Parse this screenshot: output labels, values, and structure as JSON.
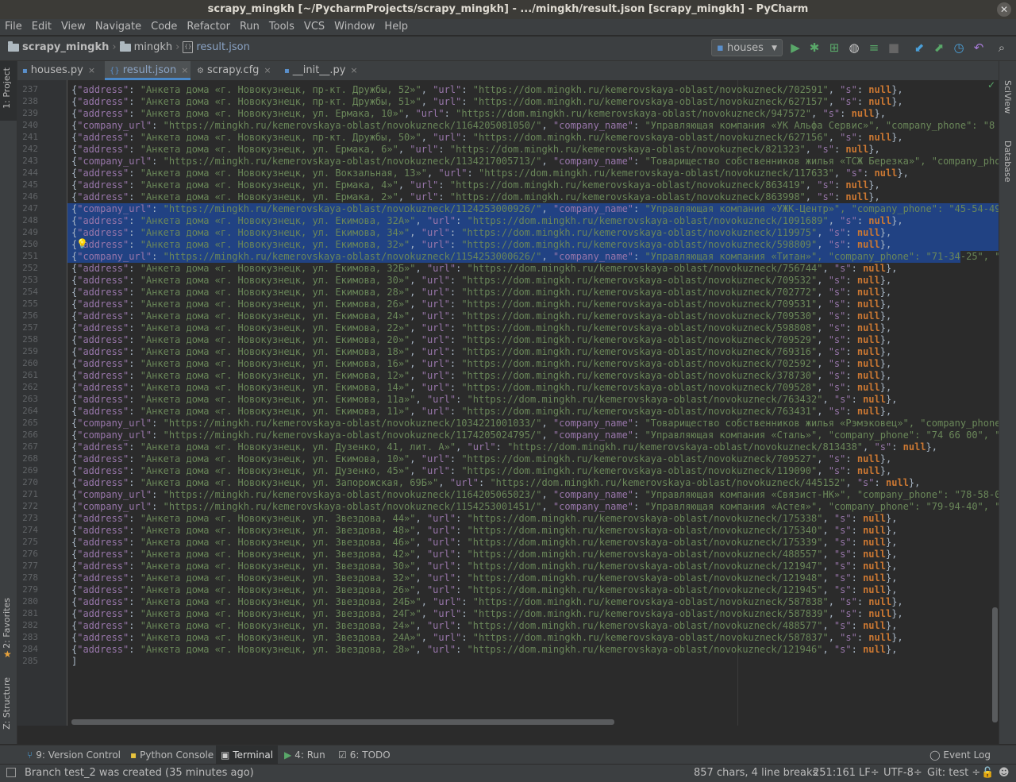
{
  "window": {
    "title": "scrapy_mingkh [~/PycharmProjects/scrapy_mingkh] - .../mingkh/result.json [scrapy_mingkh] - PyCharm"
  },
  "menu": [
    "File",
    "Edit",
    "View",
    "Navigate",
    "Code",
    "Refactor",
    "Run",
    "Tools",
    "VCS",
    "Window",
    "Help"
  ],
  "breadcrumb": {
    "project": "scrapy_mingkh",
    "folder": "mingkh",
    "file": "result.json"
  },
  "run_config": {
    "label": "houses"
  },
  "tabs": [
    {
      "label": "houses.py"
    },
    {
      "label": "result.json"
    },
    {
      "label": "scrapy.cfg"
    },
    {
      "label": "__init__.py"
    }
  ],
  "left_tools": {
    "project": "1: Project",
    "favorites": "2: Favorites",
    "structure": "Z: Structure"
  },
  "right_tools": {
    "sciview": "SciView",
    "database": "Database"
  },
  "lines": [
    {
      "n": "237",
      "t": "a",
      "addr": "Анкета дома «г. Новокузнецк, пр-кт. Дружбы, 52»",
      "id": "702591"
    },
    {
      "n": "238",
      "t": "a",
      "addr": "Анкета дома «г. Новокузнецк, пр-кт. Дружбы, 51»",
      "id": "627157"
    },
    {
      "n": "239",
      "t": "a",
      "addr": "Анкета дома «г. Новокузнецк, ул. Ермака, 10»",
      "id": "947572"
    },
    {
      "n": "240",
      "t": "c",
      "id": "1164205081050",
      "name": "Управляющая компания «УК Альфа Сервис»",
      "tail": ", \"company_phone\": \"8 (3843"
    },
    {
      "n": "241",
      "t": "a",
      "addr": "Анкета дома «г. Новокузнецк, пр-кт. Дружбы, 50»",
      "id": "627156"
    },
    {
      "n": "242",
      "t": "a",
      "addr": "Анкета дома «г. Новокузнецк, ул. Ермака, 6»",
      "id": "821323"
    },
    {
      "n": "243",
      "t": "c",
      "id": "1134217005713",
      "name": "Товарищество собственников жилья «ТСЖ Березка»",
      "tail": ", \"company_phone\":"
    },
    {
      "n": "244",
      "t": "a",
      "addr": "Анкета дома «г. Новокузнецк, ул. Вокзальная, 13»",
      "id": "117633"
    },
    {
      "n": "245",
      "t": "a",
      "addr": "Анкета дома «г. Новокузнецк, ул. Ермака, 4»",
      "id": "863419"
    },
    {
      "n": "246",
      "t": "a",
      "addr": "Анкета дома «г. Новокузнецк, ул. Ермака, 2»",
      "id": "863998"
    },
    {
      "n": "247",
      "t": "c",
      "id": "1124253000926",
      "name": "Управляющая компания «УЖК-Центр»",
      "tail": ", \"company_phone\": \"45-54-49-33-7"
    },
    {
      "n": "248",
      "t": "a",
      "addr": "Анкета дома «г. Новокузнецк, ул. Екимова, 32А»",
      "id": "1091689"
    },
    {
      "n": "249",
      "t": "a",
      "addr": "Анкета дома «г. Новокузнецк, ул. Екимова, 34»",
      "id": "119975"
    },
    {
      "n": "250",
      "t": "a",
      "addr": "Анкета дома «г. Новокузнецк, ул. Екимова, 32»",
      "id": "598809"
    },
    {
      "n": "251",
      "t": "c",
      "id": "1154253000626",
      "name": "Управляющая компания «Титан»",
      "tail": ", \"company_phone\": \"71-34-25\", \"compa"
    },
    {
      "n": "252",
      "t": "a",
      "addr": "Анкета дома «г. Новокузнецк, ул. Екимова, 32Б»",
      "id": "756744"
    },
    {
      "n": "253",
      "t": "a",
      "addr": "Анкета дома «г. Новокузнецк, ул. Екимова, 30»",
      "id": "709532"
    },
    {
      "n": "254",
      "t": "a",
      "addr": "Анкета дома «г. Новокузнецк, ул. Екимова, 28»",
      "id": "702772"
    },
    {
      "n": "255",
      "t": "a",
      "addr": "Анкета дома «г. Новокузнецк, ул. Екимова, 26»",
      "id": "709531"
    },
    {
      "n": "256",
      "t": "a",
      "addr": "Анкета дома «г. Новокузнецк, ул. Екимова, 24»",
      "id": "709530"
    },
    {
      "n": "257",
      "t": "a",
      "addr": "Анкета дома «г. Новокузнецк, ул. Екимова, 22»",
      "id": "598808"
    },
    {
      "n": "258",
      "t": "a",
      "addr": "Анкета дома «г. Новокузнецк, ул. Екимова, 20»",
      "id": "709529"
    },
    {
      "n": "259",
      "t": "a",
      "addr": "Анкета дома «г. Новокузнецк, ул. Екимова, 18»",
      "id": "769316"
    },
    {
      "n": "260",
      "t": "a",
      "addr": "Анкета дома «г. Новокузнецк, ул. Екимова, 16»",
      "id": "702592"
    },
    {
      "n": "261",
      "t": "a",
      "addr": "Анкета дома «г. Новокузнецк, ул. Екимова, 12»",
      "id": "378730"
    },
    {
      "n": "262",
      "t": "a",
      "addr": "Анкета дома «г. Новокузнецк, ул. Екимова, 14»",
      "id": "709528"
    },
    {
      "n": "263",
      "t": "a",
      "addr": "Анкета дома «г. Новокузнецк, ул. Екимова, 11а»",
      "id": "763432"
    },
    {
      "n": "264",
      "t": "a",
      "addr": "Анкета дома «г. Новокузнецк, ул. Екимова, 11»",
      "id": "763431"
    },
    {
      "n": "265",
      "t": "c",
      "id": "1034221001033",
      "name": "Товарищество собственников жилья «Рэмэковец»",
      "tail": ", \"company_phone\": \"8"
    },
    {
      "n": "266",
      "t": "c",
      "id": "1174205024795",
      "name": "Управляющая компания «Сталь»",
      "tail": ", \"company_phone\": \"74 66 00\", \"compa"
    },
    {
      "n": "267",
      "t": "a",
      "addr": "Анкета дома «г. Новокузнецк, ул. Дузенко, 41, лит. А»",
      "id": "813438"
    },
    {
      "n": "268",
      "t": "a",
      "addr": "Анкета дома «г. Новокузнецк, ул. Екимова, 10»",
      "id": "709527"
    },
    {
      "n": "269",
      "t": "a",
      "addr": "Анкета дома «г. Новокузнецк, ул. Дузенко, 45»",
      "id": "119090"
    },
    {
      "n": "270",
      "t": "a",
      "addr": "Анкета дома «г. Новокузнецк, ул. Запорожская, 69Б»",
      "id": "445152"
    },
    {
      "n": "271",
      "t": "c",
      "id": "1164205065023",
      "name": "Управляющая компания «Связист-НК»",
      "tail": ", \"company_phone\": \"78-58-01\", \""
    },
    {
      "n": "272",
      "t": "c",
      "id": "1154253001451",
      "name": "Управляющая компания «Астея»",
      "tail": ", \"company_phone\": \"79-94-40\", \"compa"
    },
    {
      "n": "273",
      "t": "a",
      "addr": "Анкета дома «г. Новокузнецк, ул. Звездова, 44»",
      "id": "175338"
    },
    {
      "n": "274",
      "t": "a",
      "addr": "Анкета дома «г. Новокузнецк, ул. Звездова, 48»",
      "id": "175340"
    },
    {
      "n": "275",
      "t": "a",
      "addr": "Анкета дома «г. Новокузнецк, ул. Звездова, 46»",
      "id": "175339"
    },
    {
      "n": "276",
      "t": "a",
      "addr": "Анкета дома «г. Новокузнецк, ул. Звездова, 42»",
      "id": "488557"
    },
    {
      "n": "277",
      "t": "a",
      "addr": "Анкета дома «г. Новокузнецк, ул. Звездова, 30»",
      "id": "121947"
    },
    {
      "n": "278",
      "t": "a",
      "addr": "Анкета дома «г. Новокузнецк, ул. Звездова, 32»",
      "id": "121948"
    },
    {
      "n": "279",
      "t": "a",
      "addr": "Анкета дома «г. Новокузнецк, ул. Звездова, 26»",
      "id": "121945"
    },
    {
      "n": "280",
      "t": "a",
      "addr": "Анкета дома «г. Новокузнецк, ул. Звездова, 24Б»",
      "id": "587838"
    },
    {
      "n": "281",
      "t": "a",
      "addr": "Анкета дома «г. Новокузнецк, ул. Звездова, 24Г»",
      "id": "587839"
    },
    {
      "n": "282",
      "t": "a",
      "addr": "Анкета дома «г. Новокузнецк, ул. Звездова, 24»",
      "id": "488577"
    },
    {
      "n": "283",
      "t": "a",
      "addr": "Анкета дома «г. Новокузнецк, ул. Звездова, 24А»",
      "id": "587837"
    },
    {
      "n": "284",
      "t": "a",
      "addr": "Анкета дома «г. Новокузнецк, ул. Звездова, 28»",
      "id": "121946"
    },
    {
      "n": "285",
      "t": "end",
      "text": "]"
    }
  ],
  "selected_lines": [
    "247",
    "248",
    "249",
    "250",
    "251"
  ],
  "bottom_tools": [
    {
      "label": "9: Version Control",
      "icon": "version-control-icon"
    },
    {
      "label": "Python Console",
      "icon": "python-icon"
    },
    {
      "label": "Terminal",
      "icon": "terminal-icon"
    },
    {
      "label": "4: Run",
      "icon": "run-icon"
    },
    {
      "label": "6: TODO",
      "icon": "todo-icon"
    }
  ],
  "event_log": "Event Log",
  "status": {
    "message": "Branch test_2 was created (35 minutes ago)",
    "chars": "857 chars, 4 line breaks",
    "position": "251:161",
    "line_sep": "LF÷",
    "encoding": "UTF-8÷",
    "git": "Git: test ÷"
  }
}
